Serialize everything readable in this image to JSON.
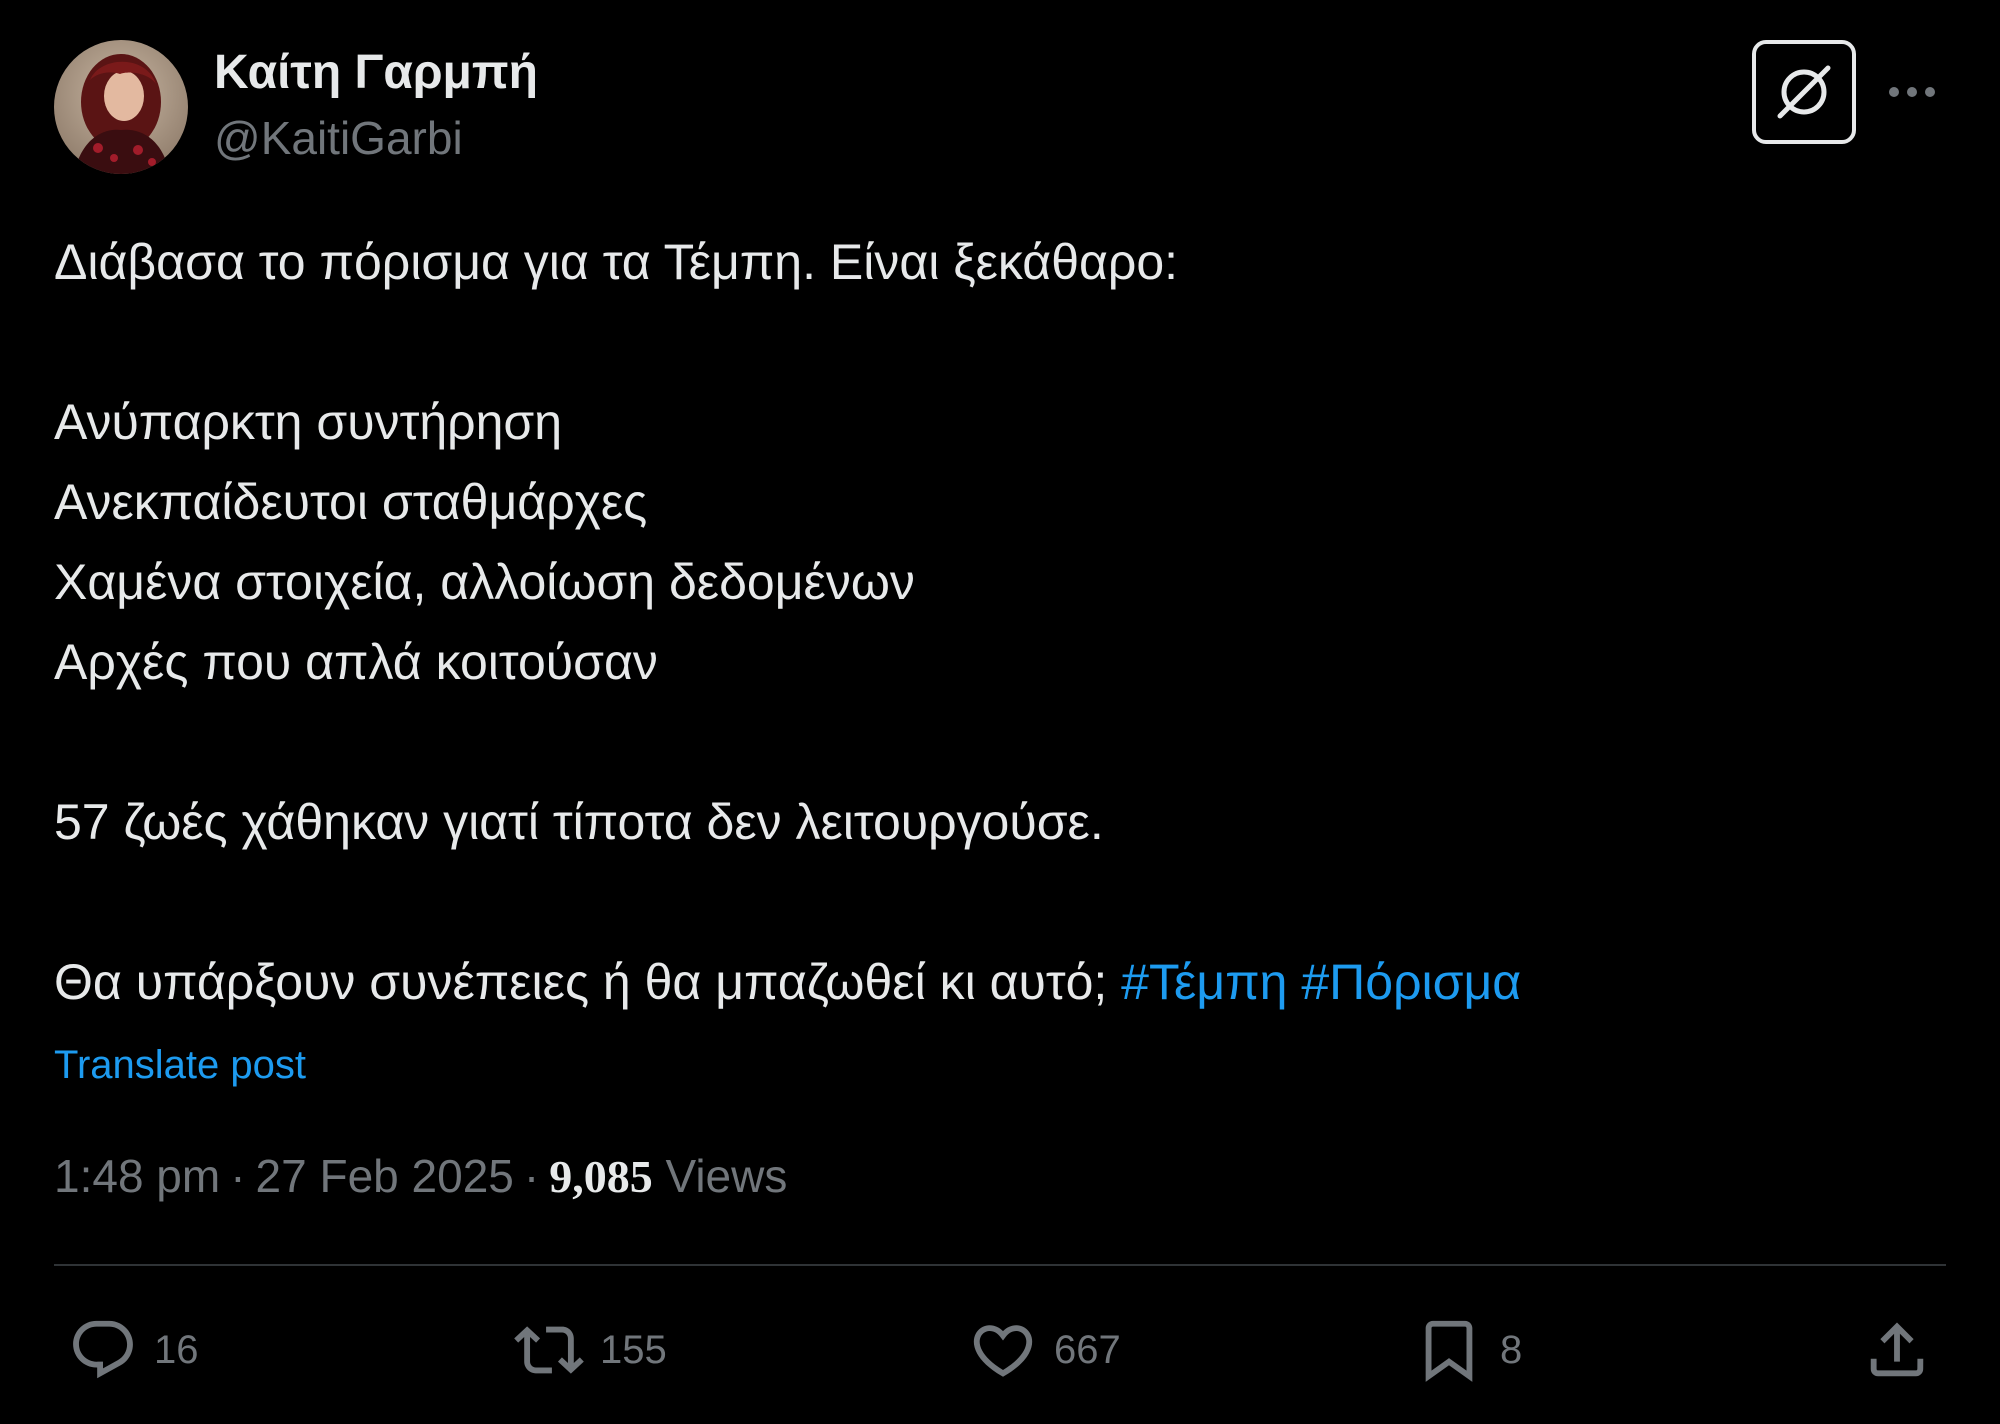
{
  "author": {
    "display_name": "Καίτη Γαρμπή",
    "handle": "@KaitiGarbi"
  },
  "icons": {
    "avatar": "profile-photo",
    "grok": "grok-icon",
    "more": "more-horizontal-icon",
    "reply": "reply-icon",
    "repost": "repost-icon",
    "like": "heart-icon",
    "bookmark": "bookmark-icon",
    "share": "share-icon"
  },
  "post": {
    "lines": [
      "Διάβασα το πόρισμα για τα Τέμπη. Είναι ξεκάθαρο:",
      "",
      "Ανύπαρκτη συντήρηση",
      "Ανεκπαίδευτοι σταθμάρχες",
      "Χαμένα στοιχεία, αλλοίωση δεδομένων",
      "Αρχές που απλά κοιτούσαν",
      "",
      "57 ζωές χάθηκαν γιατί τίποτα δεν λειτουργούσε.",
      ""
    ],
    "last_line_text": "Θα υπάρξουν συνέπειες ή θα μπαζωθεί κι αυτό; ",
    "hashtags": [
      "#Τέμπη",
      "#Πόρισμα"
    ],
    "translate_label": "Translate post"
  },
  "meta": {
    "time": "1:48 pm",
    "date": "27 Feb 2025",
    "separator": "·",
    "views_count": "9,085",
    "views_label": "Views"
  },
  "actions": {
    "replies": "16",
    "reposts": "155",
    "likes": "667",
    "bookmarks": "8"
  },
  "colors": {
    "background": "#000000",
    "text": "#e7e9ea",
    "muted": "#71767b",
    "accent": "#1d9bf0",
    "divider": "#2f3336"
  }
}
